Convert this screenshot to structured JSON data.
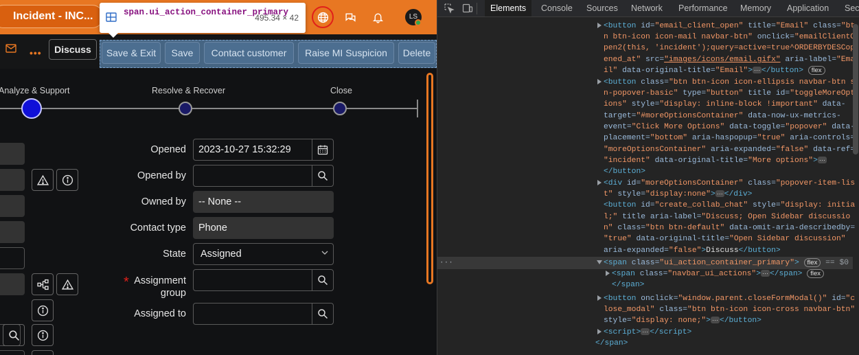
{
  "record": {
    "title": "Incident - INC..."
  },
  "inspector_tooltip": {
    "selector": "span.ui_action_container_primary",
    "dimensions": "495.34 × 42"
  },
  "topbar": {
    "avatar_initials": "LS"
  },
  "actions": {
    "discuss": "Discuss",
    "buttons": [
      "Save & Exit",
      "Save",
      "Contact customer",
      "Raise MI Suspicion",
      "Delete"
    ]
  },
  "stages": [
    "Analyze & Support",
    "Resolve & Recover",
    "Close"
  ],
  "form": {
    "opened_label": "Opened",
    "opened_value": "2023-10-27 15:32:29",
    "opened_by_label": "Opened by",
    "opened_by_value": "",
    "owned_by_label": "Owned by",
    "owned_by_value": "-- None --",
    "contact_type_label": "Contact type",
    "contact_type_value": "Phone",
    "state_label": "State",
    "state_value": "Assigned",
    "assignment_group_label": "Assignment group",
    "assignment_group_value": "",
    "assigned_to_label": "Assigned to",
    "assigned_to_value": ""
  },
  "devtools": {
    "tabs": [
      "Elements",
      "Console",
      "Sources",
      "Network",
      "Performance",
      "Memory",
      "Application",
      "Sec"
    ],
    "active_tab": "Elements"
  },
  "colors": {
    "accent": "#e87722",
    "highlight": "#6fa8dc",
    "stage_active": "#1010d8"
  },
  "icons": [
    "inspect-icon",
    "device-toggle-icon",
    "globe-icon",
    "chat-icon",
    "bell-icon",
    "mail-icon",
    "calendar-icon",
    "search-icon",
    "warning-icon",
    "info-icon",
    "hierarchy-icon"
  ]
}
